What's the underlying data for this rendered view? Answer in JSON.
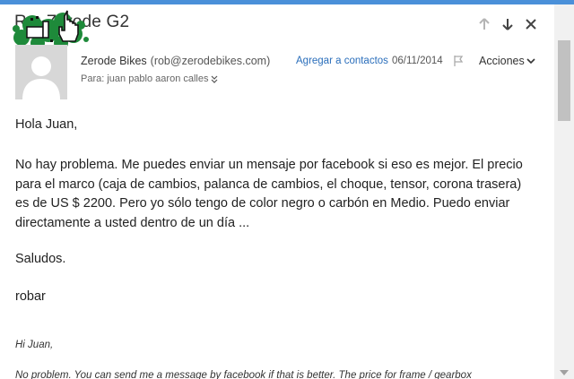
{
  "message": {
    "subject": "Re: Zerode G2",
    "sender_name": "Zerode Bikes",
    "sender_email": "(rob@zerodebikes.com)",
    "add_contact": "Agregar a contactos",
    "date": "06/11/2014",
    "actions_label": "Acciones",
    "to_line": "Para: juan pablo aaron calles"
  },
  "body": {
    "greeting": "Hola Juan,",
    "paragraph": "No hay problema. Me puedes enviar un mensaje por facebook si eso es mejor. El precio para el marco (caja de cambios, palanca de cambios, el choque, tensor, corona trasera) es de US $ 2200. Pero yo sólo tengo de color negro o carbón en Medio. Puedo enviar directamente a usted dentro de un día ...",
    "closing": "Saludos.",
    "signature": "robar",
    "quoted_greeting": "Hi Juan,",
    "quoted_paragraph": "No problem. You can send me a message by facebook if that is better. The price for frame / gearbox"
  },
  "icons": {
    "prev": "arrow-up-icon",
    "next": "arrow-down-icon",
    "close": "close-icon",
    "flag": "flag-icon",
    "avatar": "user-avatar-icon",
    "stamp": "green-stamp-logo"
  },
  "colors": {
    "accent": "#4a90d9",
    "link": "#2a6ebb",
    "stamp_green": "#1e8a3a"
  }
}
